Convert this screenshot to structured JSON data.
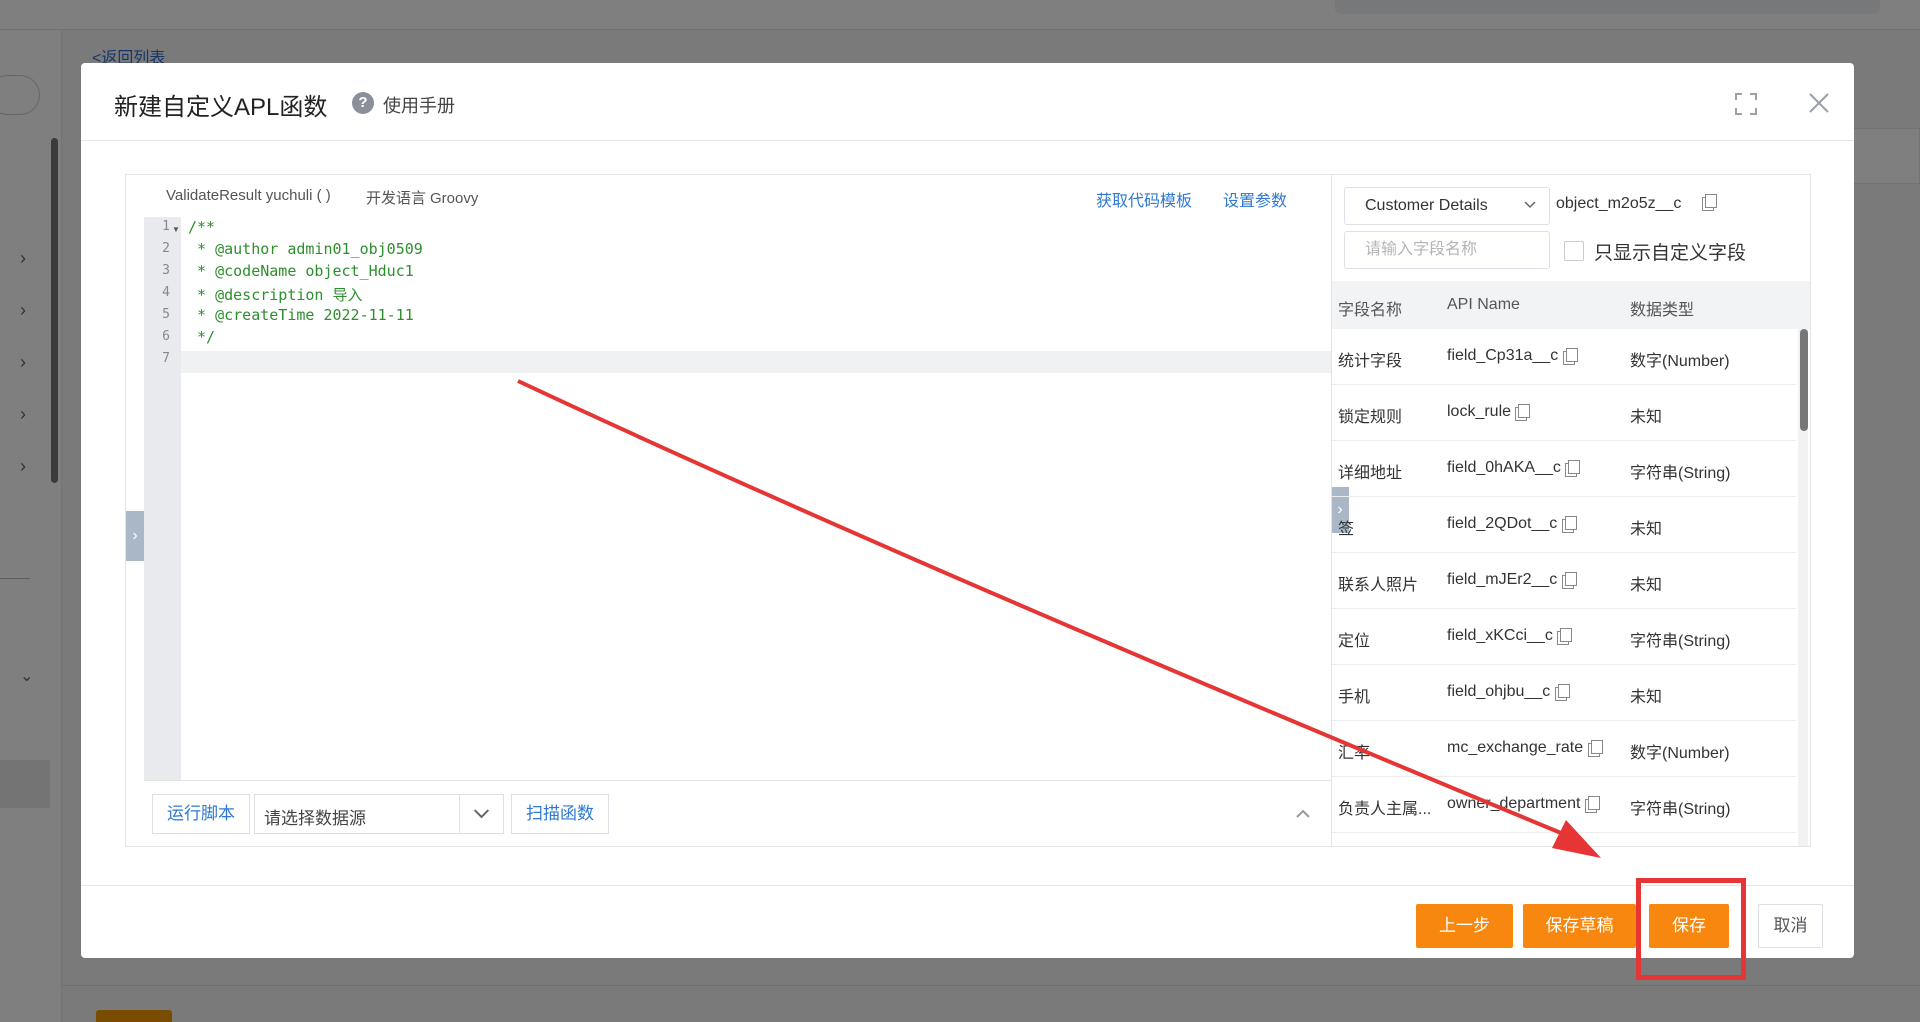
{
  "background": {
    "back_link": "<返回列表"
  },
  "dialog": {
    "title": "新建自定义APL函数",
    "help_label": "使用手册",
    "icons": {
      "help": "question-circle-icon",
      "fullscreen": "expand-icon",
      "close": "close-icon"
    }
  },
  "editor": {
    "signature": "ValidateResult yuchuli ( )",
    "language_label": "开发语言",
    "language": "Groovy",
    "links": {
      "template": "获取代码模板",
      "params": "设置参数"
    },
    "line_numbers": [
      "1",
      "2",
      "3",
      "4",
      "5",
      "6",
      "7"
    ],
    "lines": [
      "/**",
      " * @author admin01_obj0509",
      " * @codeName object_Hduc1",
      " * @description 导入",
      " * @createTime 2022-11-11",
      " */",
      ""
    ],
    "footer": {
      "run_label": "运行脚本",
      "datasource_placeholder": "请选择数据源",
      "scan_label": "扫描函数"
    }
  },
  "fields_panel": {
    "object_select": "Customer Details",
    "object_api": "object_m2o5z__c",
    "search_placeholder": "请输入字段名称",
    "custom_only_label": "只显示自定义字段",
    "columns": [
      "字段名称",
      "API Name",
      "数据类型"
    ],
    "rows": [
      {
        "name": "统计字段",
        "api": "field_Cp31a__c",
        "type": "数字(Number)"
      },
      {
        "name": "锁定规则",
        "api": "lock_rule",
        "type": "未知"
      },
      {
        "name": "详细地址",
        "api": "field_0hAKA__c",
        "type": "字符串(String)"
      },
      {
        "name": "签",
        "api": "field_2QDot__c",
        "type": "未知"
      },
      {
        "name": "联系人照片",
        "api": "field_mJEr2__c",
        "type": "未知"
      },
      {
        "name": "定位",
        "api": "field_xKCci__c",
        "type": "字符串(String)"
      },
      {
        "name": "手机",
        "api": "field_ohjbu__c",
        "type": "未知"
      },
      {
        "name": "汇率",
        "api": "mc_exchange_rate",
        "type": "数字(Number)"
      },
      {
        "name": "负责人主属...",
        "api": "owner_department",
        "type": "字符串(String)"
      }
    ]
  },
  "footer": {
    "prev_label": "上一步",
    "draft_label": "保存草稿",
    "save_label": "保存",
    "cancel_label": "取消"
  },
  "colors": {
    "primary_orange": "#f7870f",
    "link_blue": "#2f78d4",
    "annotation_red": "#e53535",
    "code_green": "#2d8f2d"
  }
}
